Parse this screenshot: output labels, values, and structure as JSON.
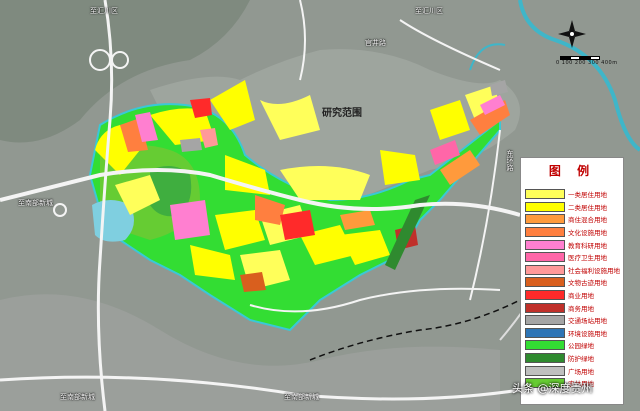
{
  "map": {
    "study_area_label": "研究范围",
    "road_labels": {
      "to_zhihui_top_left": "至汇川区",
      "to_zhihui_top_mid": "至汇川区",
      "to_nanbu_left": "至南部新城",
      "to_nanbu_bottom_left": "至南部新城",
      "to_nanbu_bottom_mid": "至南部新城",
      "road_top": "官井路",
      "road_vertical": "东环路"
    },
    "scale": {
      "text": "0 100 200 300 400m"
    },
    "compass": {
      "icon": "north-arrow-icon"
    }
  },
  "legend": {
    "title": "图 例",
    "items": [
      {
        "label": "一类居住用地",
        "color": "#ffff5a"
      },
      {
        "label": "二类居住用地",
        "color": "#ffff00"
      },
      {
        "label": "商住混合用地",
        "color": "#ff9a3c"
      },
      {
        "label": "文化设施用地",
        "color": "#ff7f3f"
      },
      {
        "label": "教育科研用地",
        "color": "#ff7fd0"
      },
      {
        "label": "医疗卫生用地",
        "color": "#ff66a8"
      },
      {
        "label": "社会福利设施用地",
        "color": "#ff9999"
      },
      {
        "label": "文物古迹用地",
        "color": "#d95f1e"
      },
      {
        "label": "商业用地",
        "color": "#ff2a2a"
      },
      {
        "label": "商务用地",
        "color": "#c0302a"
      },
      {
        "label": "交通场站用地",
        "color": "#a5a5a5"
      },
      {
        "label": "环境设施用地",
        "color": "#2e75b6"
      },
      {
        "label": "公园绿地",
        "color": "#33dd33"
      },
      {
        "label": "防护绿地",
        "color": "#2f8a2f"
      },
      {
        "label": "广场用地",
        "color": "#bfbfbf"
      },
      {
        "label": "农林用地",
        "color": "#66cc33"
      }
    ]
  },
  "watermark": "头条 @深度贵州"
}
